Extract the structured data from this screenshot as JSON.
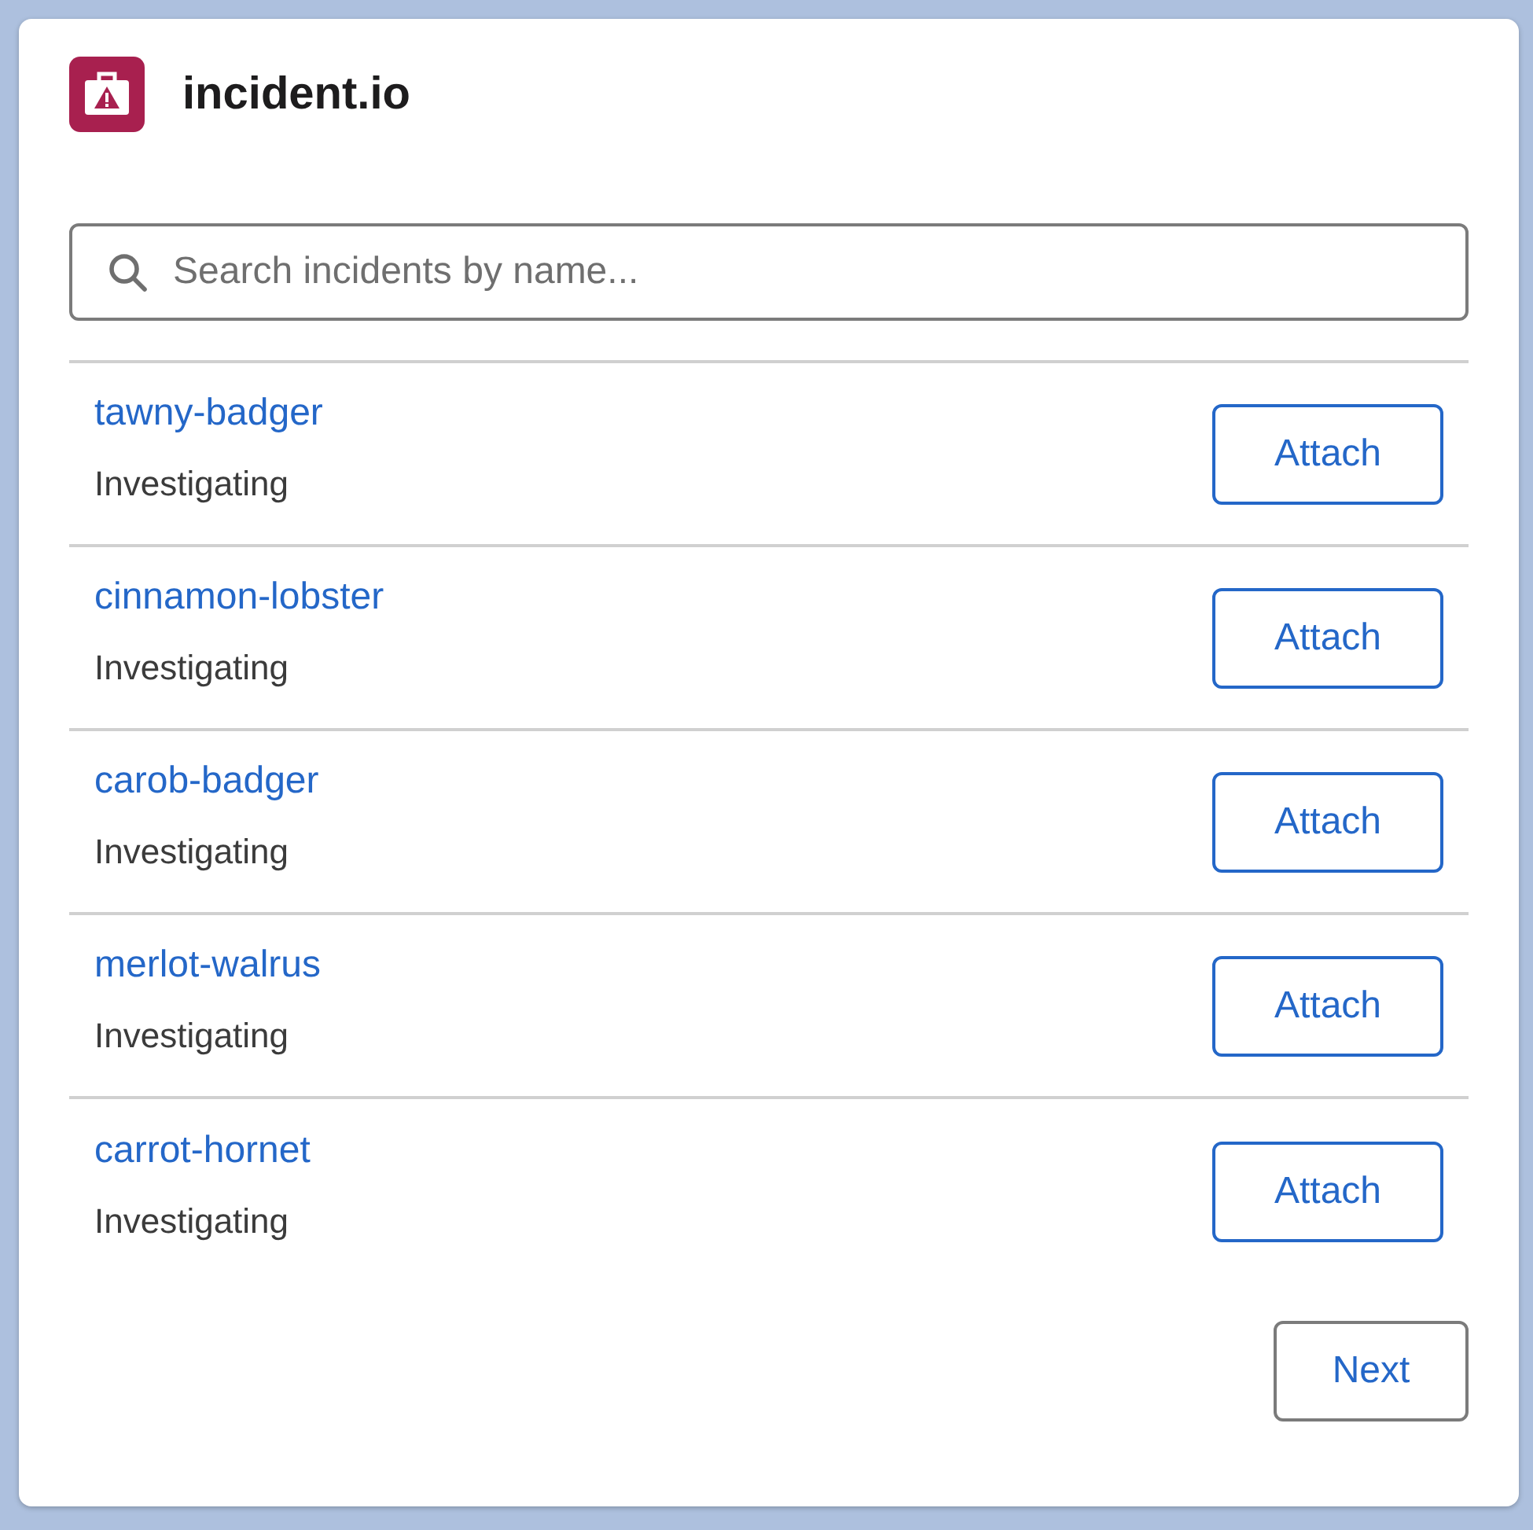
{
  "app": {
    "title": "incident.io"
  },
  "search": {
    "placeholder": "Search incidents by name..."
  },
  "incidents": [
    {
      "name": "tawny-badger",
      "status": "Investigating",
      "action": "Attach"
    },
    {
      "name": "cinnamon-lobster",
      "status": "Investigating",
      "action": "Attach"
    },
    {
      "name": "carob-badger",
      "status": "Investigating",
      "action": "Attach"
    },
    {
      "name": "merlot-walrus",
      "status": "Investigating",
      "action": "Attach"
    },
    {
      "name": "carrot-hornet",
      "status": "Investigating",
      "action": "Attach"
    }
  ],
  "pagination": {
    "next": "Next"
  }
}
